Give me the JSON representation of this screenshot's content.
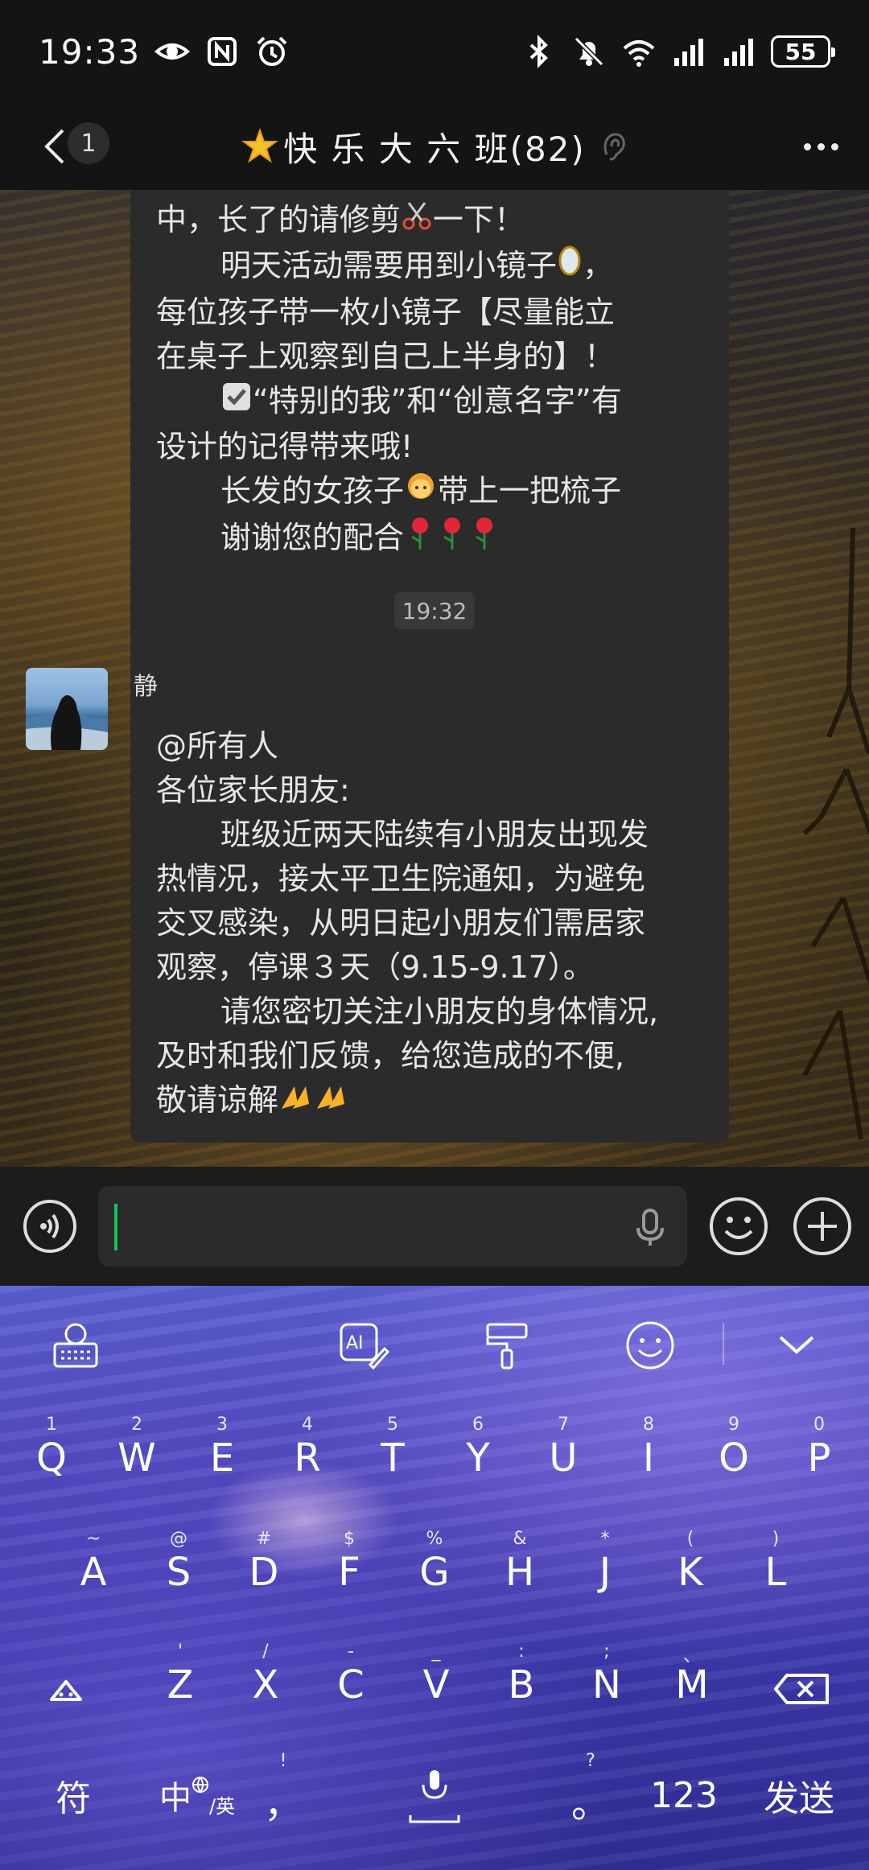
{
  "status_bar": {
    "time": "19:33",
    "battery": "55"
  },
  "nav": {
    "unread_count": "1",
    "title": "快 乐 大 六 班(82)"
  },
  "messages": {
    "msg1": {
      "lines": [
        "中，长了的请修剪",
        "一下！",
        "明天活动需要用到小镜子",
        "，",
        "每位孩子带一枚小镜子【尽量能立",
        "在桌子上观察到自己上半身的】！",
        "“特别的我”和“创意名字”有",
        "设计的记得带来哦!",
        "长发的女孩子",
        "带上一把梳子",
        "谢谢您的配合"
      ]
    },
    "time_separator": "19:32",
    "msg2": {
      "sender": "静",
      "lines": [
        "@所有人",
        "各位家长朋友:",
        "班级近两天陆续有小朋友出现发",
        "热情况，接太平卫生院通知，为避免",
        "交叉感染，从明日起小朋友们需居家",
        "观察，停课３天（9.15-9.17）。",
        "请您密切关注小朋友的身体情况,",
        "及时和我们反馈，给您造成的不便,",
        "敬请谅解"
      ]
    }
  },
  "input": {
    "value": ""
  },
  "keyboard": {
    "row1": [
      {
        "main": "Q",
        "sub": "1"
      },
      {
        "main": "W",
        "sub": "2"
      },
      {
        "main": "E",
        "sub": "3"
      },
      {
        "main": "R",
        "sub": "4"
      },
      {
        "main": "T",
        "sub": "5"
      },
      {
        "main": "Y",
        "sub": "6"
      },
      {
        "main": "U",
        "sub": "7"
      },
      {
        "main": "I",
        "sub": "8"
      },
      {
        "main": "O",
        "sub": "9"
      },
      {
        "main": "P",
        "sub": "0"
      }
    ],
    "row2": [
      {
        "main": "A",
        "sub": "~"
      },
      {
        "main": "S",
        "sub": "@"
      },
      {
        "main": "D",
        "sub": "#"
      },
      {
        "main": "F",
        "sub": "$"
      },
      {
        "main": "G",
        "sub": "%"
      },
      {
        "main": "H",
        "sub": "&"
      },
      {
        "main": "J",
        "sub": "*"
      },
      {
        "main": "K",
        "sub": "("
      },
      {
        "main": "L",
        "sub": ")"
      }
    ],
    "row3": [
      {
        "main": "Z",
        "sub": "'"
      },
      {
        "main": "X",
        "sub": "/"
      },
      {
        "main": "C",
        "sub": "-"
      },
      {
        "main": "V",
        "sub": "_"
      },
      {
        "main": "B",
        "sub": ":"
      },
      {
        "main": "N",
        "sub": ";"
      },
      {
        "main": "M",
        "sub": "、"
      }
    ],
    "symbol_key": "符",
    "lang_key": "中",
    "lang_key_sub": "/英",
    "comma_key": "，",
    "comma_key_sub": "!",
    "period_key": "。",
    "period_key_sub": "?",
    "num_key": "123",
    "send_key": "发送"
  }
}
